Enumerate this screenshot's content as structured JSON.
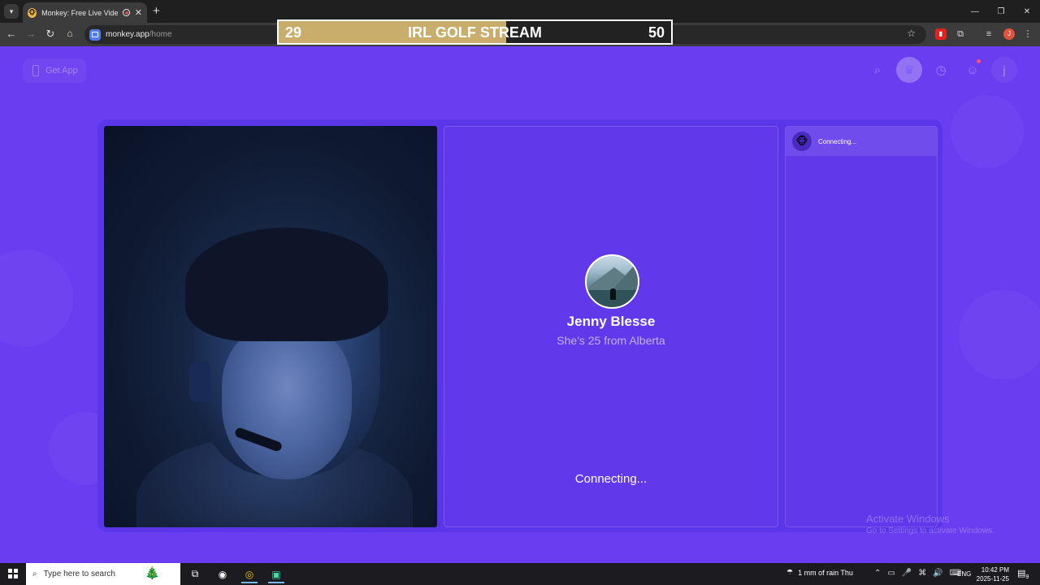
{
  "browser": {
    "tab_title": "Monkey: Free Live Video Ch",
    "tab_close": "✕",
    "new_tab": "+",
    "url_host": "monkey.app",
    "url_path": "/home",
    "window_controls": [
      "—",
      "❐",
      "✕"
    ],
    "profile_initial": "J"
  },
  "stream_overlay": {
    "left_value": "29",
    "title": "IRL GOLF STREAM",
    "right_value": "50",
    "progress": 0.58,
    "fill_color": "#c9ad6c"
  },
  "header": {
    "get_app_label": "Get App",
    "user_initial": "j"
  },
  "match": {
    "name": "Jenny Blesse",
    "info": "She's 25 from Alberta",
    "status": "Connecting..."
  },
  "chat": {
    "status": "Connecting..."
  },
  "watermark": {
    "line1": "Activate Windows",
    "line2": "Go to Settings to activate Windows."
  },
  "taskbar": {
    "search_placeholder": "Type here to search",
    "weather": "1 mm of rain Thu",
    "language": "ENG",
    "time": "10:42 PM",
    "date": "2025-11-25",
    "notification_count": "9"
  },
  "colors": {
    "page_bg": "#6a3df0",
    "panel_bg": "#6138ea",
    "accent": "#7f5cf5"
  }
}
